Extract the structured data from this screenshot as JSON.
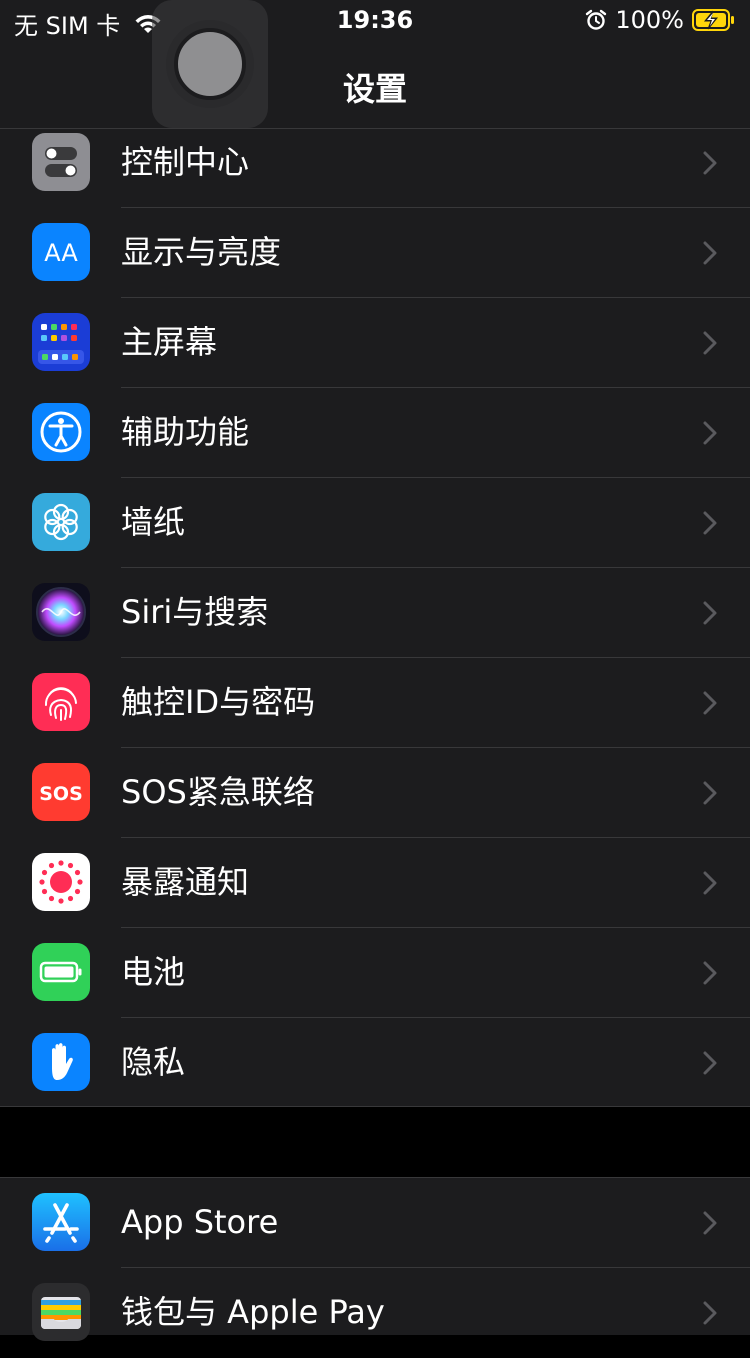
{
  "status_bar": {
    "carrier": "无 SIM 卡",
    "time": "19:36",
    "battery": "100%"
  },
  "nav": {
    "title": "设置"
  },
  "group1": [
    {
      "label": "控制中心",
      "icon": "control-center-icon",
      "color": "#8e8e93"
    },
    {
      "label": "显示与亮度",
      "icon": "display-brightness-icon",
      "color": "#0a84ff"
    },
    {
      "label": "主屏幕",
      "icon": "home-screen-icon",
      "color": "#1b3dd6"
    },
    {
      "label": "辅助功能",
      "icon": "accessibility-icon",
      "color": "#0a84ff"
    },
    {
      "label": "墙纸",
      "icon": "wallpaper-icon",
      "color": "#35aadc"
    },
    {
      "label": "Siri与搜索",
      "icon": "siri-icon",
      "color": "#1c1c2e"
    },
    {
      "label": "触控ID与密码",
      "icon": "touch-id-icon",
      "color": "#ff2d55"
    },
    {
      "label": "SOS紧急联络",
      "icon": "sos-icon",
      "color": "#ff3b30"
    },
    {
      "label": "暴露通知",
      "icon": "exposure-notification-icon",
      "color": "#ffffff"
    },
    {
      "label": "电池",
      "icon": "battery-icon",
      "color": "#30d158"
    },
    {
      "label": "隐私",
      "icon": "privacy-hand-icon",
      "color": "#0a84ff"
    }
  ],
  "group2": [
    {
      "label": "App Store",
      "icon": "app-store-icon",
      "color": "#1e90ff"
    },
    {
      "label": "钱包与 Apple Pay",
      "icon": "wallet-icon",
      "color": "#2c2c2e"
    }
  ]
}
